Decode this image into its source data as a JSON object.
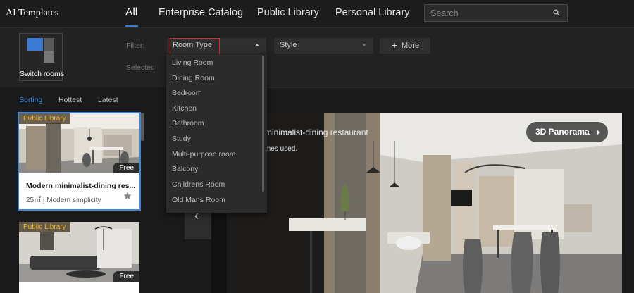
{
  "app": {
    "title": "AI Templates"
  },
  "nav": {
    "tabs": [
      {
        "label": "All",
        "active": true
      },
      {
        "label": "Enterprise Catalog"
      },
      {
        "label": "Public Library"
      },
      {
        "label": "Personal Library"
      }
    ]
  },
  "search": {
    "placeholder": "Search",
    "icon": "search-icon"
  },
  "switch_rooms": {
    "label": "Switch rooms"
  },
  "filter": {
    "label": "Filter:",
    "selected_label": "Selected",
    "room_type": {
      "value": "Room Type",
      "expanded": true
    },
    "style": {
      "value": "Style"
    },
    "more": {
      "label": "More"
    },
    "room_type_options": [
      "Living Room",
      "Dining Room",
      "Bedroom",
      "Kitchen",
      "Bathroom",
      "Study",
      "Multi-purpose room",
      "Balcony",
      "Childrens Room",
      "Old Mans Room"
    ]
  },
  "sorting": {
    "tabs": [
      {
        "label": "Sorting",
        "active": true
      },
      {
        "label": "Hottest"
      },
      {
        "label": "Latest"
      }
    ]
  },
  "cards": [
    {
      "badge": "Public Library",
      "price": "Free",
      "title": "Modern minimalist-dining res...",
      "subtitle": "25㎡ | Modern simplicity",
      "active": true
    },
    {
      "badge": "Public Library",
      "price": "Free",
      "title": "",
      "subtitle": ""
    }
  ],
  "preview": {
    "title": "minimalist-dining restaurant",
    "subtitle": "mes used.",
    "panorama_button": "3D Panorama"
  },
  "colors": {
    "accent": "#2f7fd6",
    "badge_text": "#f0b429",
    "highlight": "#d9262c"
  }
}
